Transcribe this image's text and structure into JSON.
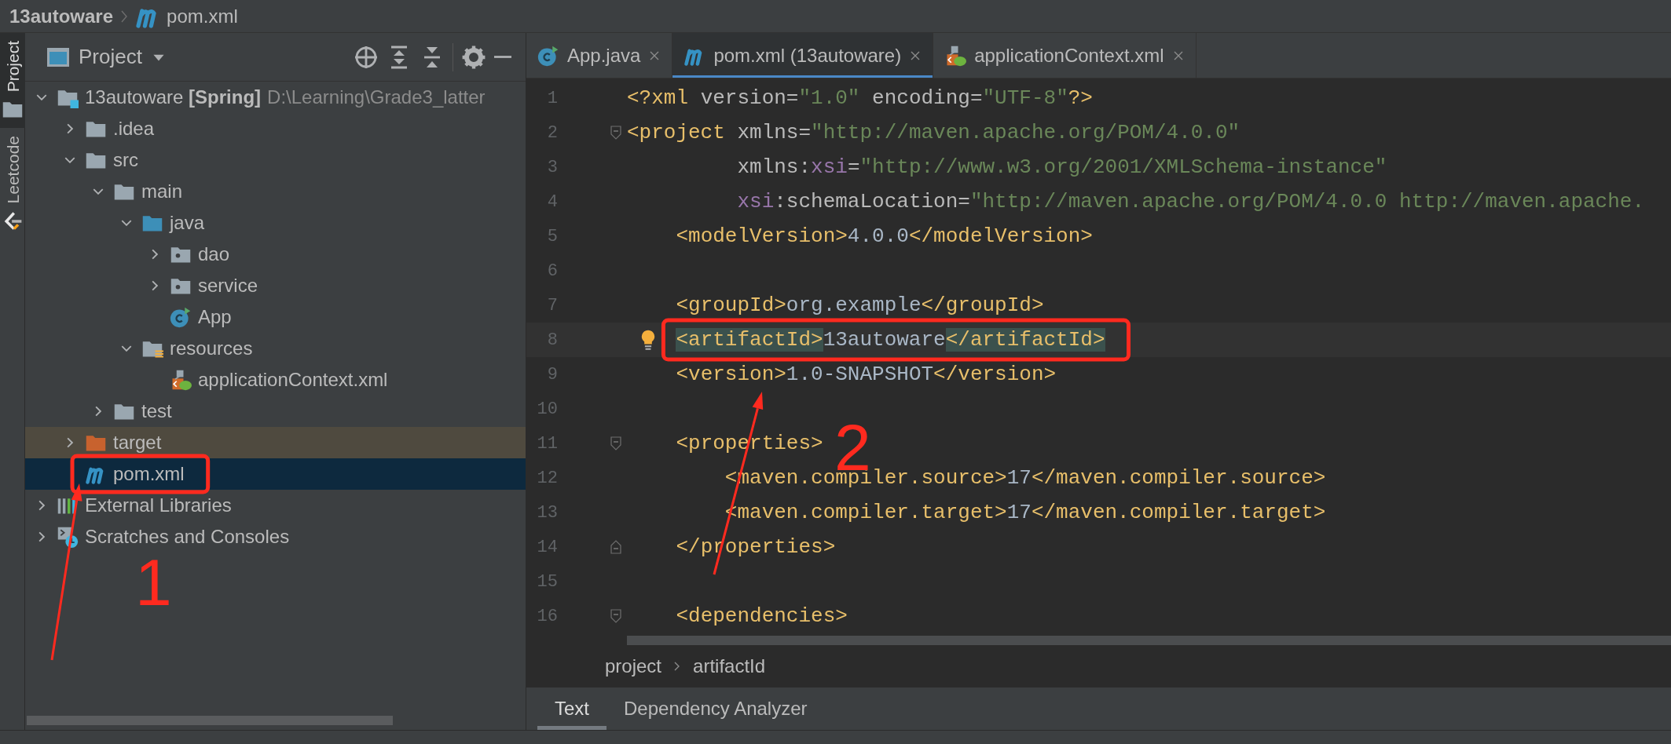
{
  "title_bar": {
    "project": "13autoware",
    "file": "pom.xml"
  },
  "tool_strip": [
    {
      "label": "Project",
      "kind": "folder",
      "selected": true
    },
    {
      "label": "Leetcode",
      "kind": "leetcode",
      "selected": false
    }
  ],
  "project_panel": {
    "title": "Project",
    "tree": [
      {
        "label": "13autoware",
        "tag": "[Spring]",
        "path": "D:\\Learning\\Grade3_latter",
        "kind": "module",
        "expanded": true,
        "selected": false,
        "excluded": false,
        "children": [
          {
            "label": ".idea",
            "kind": "folder",
            "expanded": false,
            "selected": false,
            "excluded": false
          },
          {
            "label": "src",
            "kind": "folder",
            "expanded": true,
            "selected": false,
            "excluded": false,
            "children": [
              {
                "label": "main",
                "kind": "folder",
                "expanded": true,
                "selected": false,
                "excluded": false,
                "children": [
                  {
                    "label": "java",
                    "kind": "source_folder",
                    "expanded": true,
                    "selected": false,
                    "excluded": false,
                    "children": [
                      {
                        "label": "dao",
                        "kind": "package",
                        "expanded": false,
                        "selected": false,
                        "excluded": false
                      },
                      {
                        "label": "service",
                        "kind": "package",
                        "expanded": false,
                        "selected": false,
                        "excluded": false
                      },
                      {
                        "label": "App",
                        "kind": "class",
                        "selected": false,
                        "excluded": false
                      }
                    ]
                  },
                  {
                    "label": "resources",
                    "kind": "resources_folder",
                    "expanded": true,
                    "selected": false,
                    "excluded": false,
                    "children": [
                      {
                        "label": "applicationContext.xml",
                        "kind": "spring_xml",
                        "selected": false,
                        "excluded": false
                      }
                    ]
                  }
                ]
              },
              {
                "label": "test",
                "kind": "folder",
                "expanded": false,
                "selected": false,
                "excluded": false
              }
            ]
          },
          {
            "label": "target",
            "kind": "excluded_folder",
            "expanded": false,
            "selected": false,
            "excluded": true
          },
          {
            "label": "pom.xml",
            "kind": "maven",
            "selected": true,
            "excluded": false,
            "annotated": true
          }
        ]
      },
      {
        "label": "External Libraries",
        "kind": "libraries",
        "expanded": false,
        "selected": false,
        "excluded": false
      },
      {
        "label": "Scratches and Consoles",
        "kind": "scratches",
        "expanded": false,
        "selected": false,
        "excluded": false
      }
    ]
  },
  "editor": {
    "tabs": [
      {
        "label": "App.java",
        "kind": "class",
        "selected": false
      },
      {
        "label": "pom.xml (13autoware)",
        "kind": "maven",
        "selected": true
      },
      {
        "label": "applicationContext.xml",
        "kind": "spring_xml",
        "selected": false
      }
    ],
    "lines": [
      {
        "number": "1",
        "tokens": [
          {
            "kind": "tag",
            "text": "<?xml"
          },
          {
            "kind": "attr",
            "text": " version="
          },
          {
            "kind": "value",
            "text": "\"1.0\""
          },
          {
            "kind": "attr",
            "text": " encoding="
          },
          {
            "kind": "value",
            "text": "\"UTF-8\""
          },
          {
            "kind": "tag",
            "text": "?>"
          }
        ]
      },
      {
        "number": "2",
        "fold_start": true,
        "tokens": [
          {
            "kind": "tag",
            "text": "<project"
          },
          {
            "kind": "attr",
            "text": " xmlns="
          },
          {
            "kind": "value",
            "text": "\"http://maven.apache.org/POM/4.0.0\""
          }
        ]
      },
      {
        "number": "3",
        "tokens": [
          {
            "kind": "attr",
            "text": "         xmlns:"
          },
          {
            "kind": "ns",
            "text": "xsi"
          },
          {
            "kind": "attr",
            "text": "="
          },
          {
            "kind": "value",
            "text": "\"http://www.w3.org/2001/XMLSchema-instance\""
          }
        ]
      },
      {
        "number": "4",
        "tokens": [
          {
            "kind": "ns",
            "text": "         xsi"
          },
          {
            "kind": "attr",
            "text": ":schemaLocation="
          },
          {
            "kind": "value",
            "text": "\"http://maven.apache.org/POM/4.0.0 http://maven.apache."
          }
        ]
      },
      {
        "number": "5",
        "tokens": [
          {
            "kind": "tag",
            "text": "    <modelVersion>"
          },
          {
            "kind": "text",
            "text": "4.0.0"
          },
          {
            "kind": "tag",
            "text": "</modelVersion>"
          }
        ]
      },
      {
        "number": "6"
      },
      {
        "number": "7",
        "tokens": [
          {
            "kind": "tag",
            "text": "    <groupId>"
          },
          {
            "kind": "text",
            "text": "org.example"
          },
          {
            "kind": "tag",
            "text": "</groupId>"
          }
        ]
      },
      {
        "number": "8",
        "current": true,
        "bulb": true,
        "annotated": true,
        "tokens": [
          {
            "kind": "tag",
            "text": "    <artifactId>",
            "matched": true
          },
          {
            "kind": "text",
            "text": "13autoware"
          },
          {
            "kind": "tag",
            "text": "</artifactId>",
            "matched": true
          }
        ]
      },
      {
        "number": "9",
        "tokens": [
          {
            "kind": "tag",
            "text": "    <version>"
          },
          {
            "kind": "text",
            "text": "1.0-SNAPSHOT"
          },
          {
            "kind": "tag",
            "text": "</version>"
          }
        ]
      },
      {
        "number": "10"
      },
      {
        "number": "11",
        "fold_start": true,
        "tokens": [
          {
            "kind": "tag",
            "text": "    <properties>"
          }
        ]
      },
      {
        "number": "12",
        "tokens": [
          {
            "kind": "tag",
            "text": "        <maven.compiler.source>"
          },
          {
            "kind": "text",
            "text": "17"
          },
          {
            "kind": "tag",
            "text": "</maven.compiler.source>"
          }
        ]
      },
      {
        "number": "13",
        "tokens": [
          {
            "kind": "tag",
            "text": "        <maven.compiler.target>"
          },
          {
            "kind": "text",
            "text": "17"
          },
          {
            "kind": "tag",
            "text": "</maven.compiler.target>"
          }
        ]
      },
      {
        "number": "14",
        "fold_end": true,
        "tokens": [
          {
            "kind": "tag",
            "text": "    </properties>"
          }
        ]
      },
      {
        "number": "15"
      },
      {
        "number": "16",
        "fold_start": true,
        "tokens": [
          {
            "kind": "tag",
            "text": "    <dependencies>"
          }
        ]
      }
    ],
    "breadcrumbs": [
      "project",
      "artifactId"
    ],
    "bottom_tabs": [
      {
        "label": "Text",
        "selected": true
      },
      {
        "label": "Dependency Analyzer",
        "selected": false
      }
    ]
  },
  "annotations": [
    {
      "kind": "number",
      "text": "1"
    },
    {
      "kind": "number",
      "text": "2"
    }
  ]
}
